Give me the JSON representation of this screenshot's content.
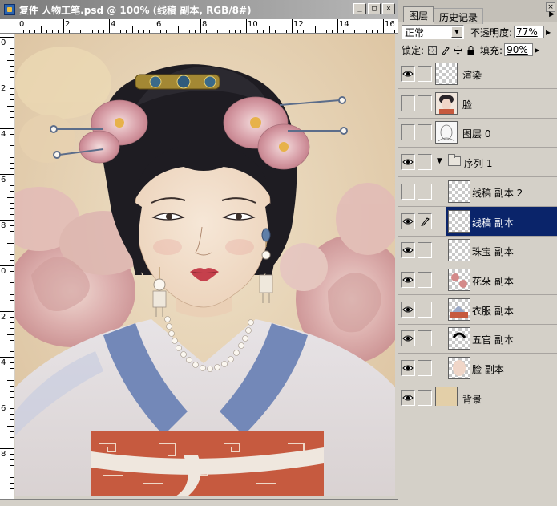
{
  "document": {
    "title": "复件 人物工笔.psd @ 100% (线稿 副本, RGB/8#)",
    "min_btn": "_",
    "max_btn": "□",
    "close_btn": "×",
    "ruler_top_labels": [
      "0",
      "2",
      "4",
      "6",
      "8",
      "10",
      "12",
      "14",
      "16"
    ],
    "ruler_left_labels": [
      "0",
      "2",
      "4",
      "6",
      "8",
      "0",
      "2",
      "4",
      "6",
      "8"
    ]
  },
  "layers_panel": {
    "tabs": [
      {
        "label": "图层",
        "active": true
      },
      {
        "label": "历史记录",
        "active": false
      }
    ],
    "close_btn": "×",
    "menu_arrow": "▶",
    "blend_mode": "正常",
    "opacity_label": "不透明度:",
    "opacity_value": "77%",
    "lock_label": "锁定:",
    "fill_label": "填充:",
    "fill_value": "90%",
    "layers": [
      {
        "name": "渲染",
        "visible": true,
        "thumb": "transparent"
      },
      {
        "name": "脸",
        "visible": false,
        "thumb": "portrait"
      },
      {
        "name": "图层 0",
        "visible": false,
        "thumb": "sketch"
      },
      {
        "name": "序列 1",
        "visible": true,
        "type": "group"
      },
      {
        "name": "线稿 副本 2",
        "visible": false,
        "nested": true,
        "thumb": "transparent"
      },
      {
        "name": "线稿 副本",
        "visible": true,
        "nested": true,
        "selected": true,
        "thumb": "transparent"
      },
      {
        "name": "珠宝 副本",
        "visible": true,
        "nested": true,
        "thumb": "transparent"
      },
      {
        "name": "花朵  副本",
        "visible": true,
        "nested": true,
        "thumb": "flowers"
      },
      {
        "name": "衣服 副本",
        "visible": true,
        "nested": true,
        "thumb": "clothes"
      },
      {
        "name": "五官 副本",
        "visible": true,
        "nested": true,
        "thumb": "features"
      },
      {
        "name": "脸 副本",
        "visible": true,
        "nested": true,
        "thumb": "face"
      },
      {
        "name": "背景",
        "visible": true,
        "thumb": "background"
      }
    ]
  },
  "colors": {
    "selection": "#0a246a",
    "canvas_bg": "#e6d3b6",
    "robe_blue": "#7388b8",
    "sash_red": "#c65a3f",
    "hair": "#1e1c22",
    "peony": "#d9a0a8"
  }
}
